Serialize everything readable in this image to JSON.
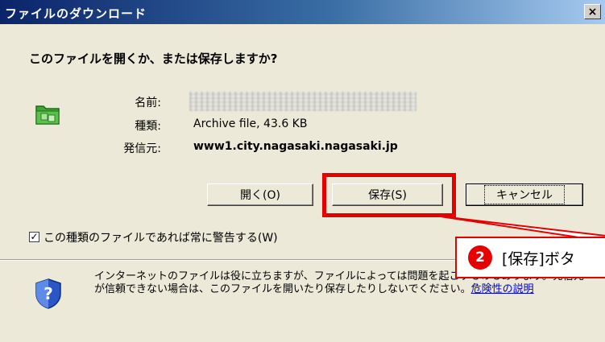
{
  "titlebar": {
    "title": "ファイルのダウンロード",
    "close_label": "×"
  },
  "dialog": {
    "question": "このファイルを開くか、または保存しますか?",
    "file_icon": "folder-archive-icon",
    "info": [
      {
        "label": "名前:",
        "value": ""
      },
      {
        "label": "種類:",
        "value": "Archive file, 43.6 KB"
      },
      {
        "label": "発信元:",
        "value": "www1.city.nagasaki.nagasaki.jp"
      }
    ],
    "buttons": {
      "open": "開く(O)",
      "save": "保存(S)",
      "cancel": "キャンセル"
    },
    "checkbox": {
      "checked": true,
      "label": "この種類のファイルであれば常に警告する(W)"
    },
    "warning": {
      "icon": "shield-question-icon",
      "text": "インターネットのファイルは役に立ちますが、ファイルによっては問題を起こすものもあります。発信元が信頼できない場合は、このファイルを開いたり保存したりしないでください。",
      "link": "危険性の説明"
    }
  },
  "annotation": {
    "number": "2",
    "text": "[保存]ボタ",
    "color": "#e60000"
  }
}
